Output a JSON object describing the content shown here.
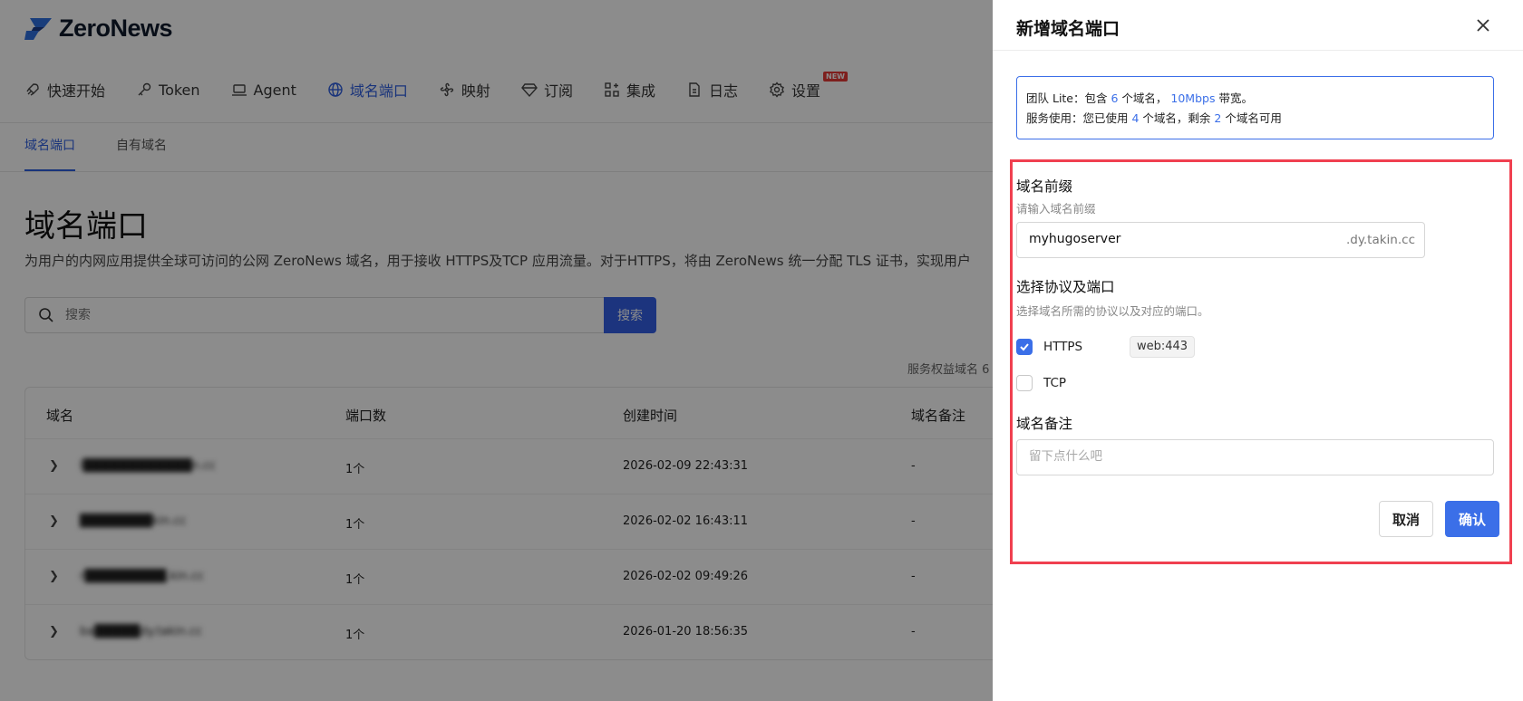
{
  "app": {
    "logo_text": "ZeroNews"
  },
  "nav": {
    "items": [
      {
        "label": "快速开始",
        "icon": "rocket-icon"
      },
      {
        "label": "Token",
        "icon": "key-icon"
      },
      {
        "label": "Agent",
        "icon": "laptop-icon"
      },
      {
        "label": "域名端口",
        "icon": "globe-icon",
        "active": true
      },
      {
        "label": "映射",
        "icon": "fan-icon"
      },
      {
        "label": "订阅",
        "icon": "diamond-icon"
      },
      {
        "label": "集成",
        "icon": "grid-plus-icon"
      },
      {
        "label": "日志",
        "icon": "document-icon"
      },
      {
        "label": "设置",
        "icon": "gear-icon",
        "badge": "NEW"
      }
    ]
  },
  "subtabs": {
    "items": [
      "域名端口",
      "自有域名"
    ]
  },
  "main": {
    "title": "域名端口",
    "description": "为用户的内网应用提供全球可访问的公网 ZeroNews 域名，用于接收 HTTPS及TCP 应用流量。对于HTTPS，将由 ZeroNews 统一分配 TLS 证书，实现用户",
    "search_placeholder": "搜索",
    "search_button": "搜索",
    "quota_text": "服务权益域名 6"
  },
  "table": {
    "columns": [
      "域名",
      "端口数",
      "创建时间",
      "域名备注"
    ],
    "rows": [
      {
        "domain": "l████████████n.cc",
        "ports": "1个",
        "created": "2026-02-09 22:43:31",
        "note": "-"
      },
      {
        "domain": "████████kin.cc",
        "ports": "1个",
        "created": "2026-02-02 16:43:11",
        "note": "-"
      },
      {
        "domain": "r█████████.kin.cc",
        "ports": "1个",
        "created": "2026-02-02 09:49:26",
        "note": "-"
      },
      {
        "domain": "ba█████dy.takin.cc",
        "ports": "1个",
        "created": "2026-01-20 18:56:35",
        "note": "-"
      }
    ]
  },
  "drawer": {
    "title": "新增域名端口",
    "info": {
      "line1_a": "团队 Lite：包含 ",
      "line1_count": "6",
      "line1_b": " 个域名， ",
      "line1_bw": "10Mbps",
      "line1_c": " 带宽。",
      "line2_a": "服务使用：您已使用 ",
      "line2_used": "4",
      "line2_b": " 个域名，剩余 ",
      "line2_left": "2",
      "line2_c": " 个域名可用"
    },
    "prefix": {
      "label": "域名前缀",
      "hint": "请输入域名前缀",
      "value": "myhugoserver",
      "suffix": ".dy.takin.cc"
    },
    "protocol": {
      "label": "选择协议及端口",
      "hint": "选择域名所需的协议以及对应的端口。",
      "options": [
        {
          "name": "HTTPS",
          "checked": true,
          "port": "web:443"
        },
        {
          "name": "TCP",
          "checked": false
        }
      ]
    },
    "note": {
      "label": "域名备注",
      "placeholder": "留下点什么吧"
    },
    "cancel_label": "取消",
    "confirm_label": "确认"
  },
  "colors": {
    "accent": "#3b6fe8",
    "highlight_frame": "#f04050",
    "overlay": "rgba(0,0,0,0.45)"
  }
}
